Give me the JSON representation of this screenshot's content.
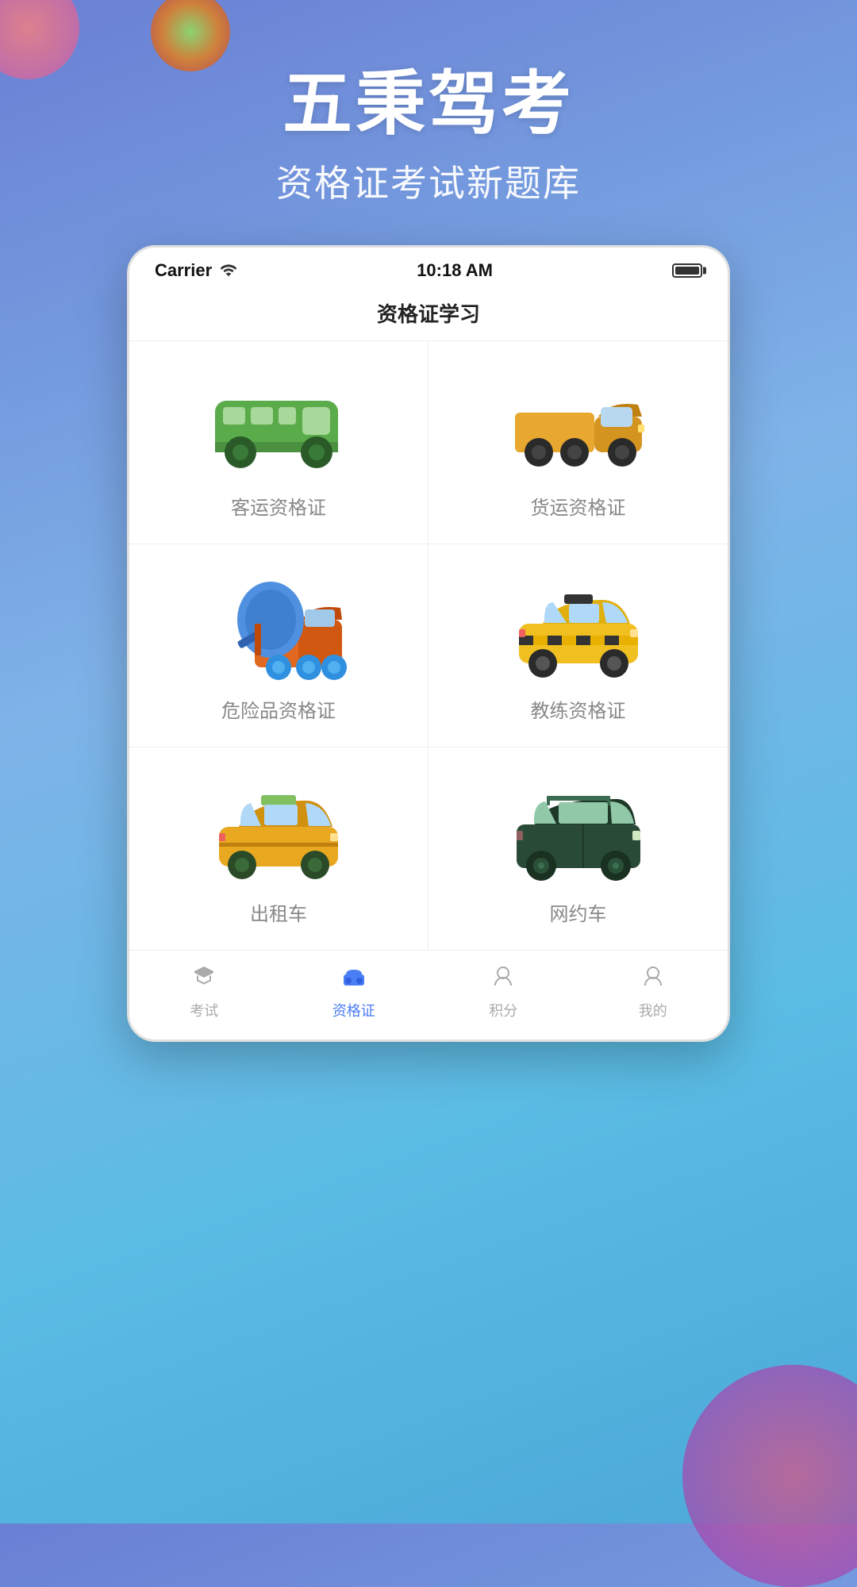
{
  "app": {
    "title": "五秉驾考",
    "subtitle": "资格证考试新题库"
  },
  "status_bar": {
    "carrier": "Carrier",
    "wifi": "wifi",
    "time": "10:18 AM",
    "battery": "full"
  },
  "nav": {
    "title": "资格证学习"
  },
  "categories": [
    {
      "id": "passenger",
      "label": "客运资格证",
      "vehicle": "green_bus"
    },
    {
      "id": "freight",
      "label": "货运资格证",
      "vehicle": "yellow_truck"
    },
    {
      "id": "hazmat",
      "label": "危险品资格证",
      "vehicle": "cement_mixer"
    },
    {
      "id": "trainer",
      "label": "教练资格证",
      "vehicle": "taxi"
    },
    {
      "id": "taxi_out",
      "label": "出租车",
      "vehicle": "yellow_cab"
    },
    {
      "id": "rideshare",
      "label": "网约车",
      "vehicle": "dark_suv"
    }
  ],
  "tabs": [
    {
      "id": "exam",
      "label": "考试",
      "icon": "🎓",
      "active": false
    },
    {
      "id": "cert",
      "label": "资格证",
      "icon": "🚗",
      "active": true
    },
    {
      "id": "points",
      "label": "积分",
      "icon": "👤",
      "active": false
    },
    {
      "id": "mine",
      "label": "我的",
      "icon": "👤",
      "active": false
    }
  ],
  "colors": {
    "active_tab": "#4a7ef5",
    "inactive_tab": "#aaa",
    "cell_border": "#eee",
    "label_color": "#888"
  }
}
